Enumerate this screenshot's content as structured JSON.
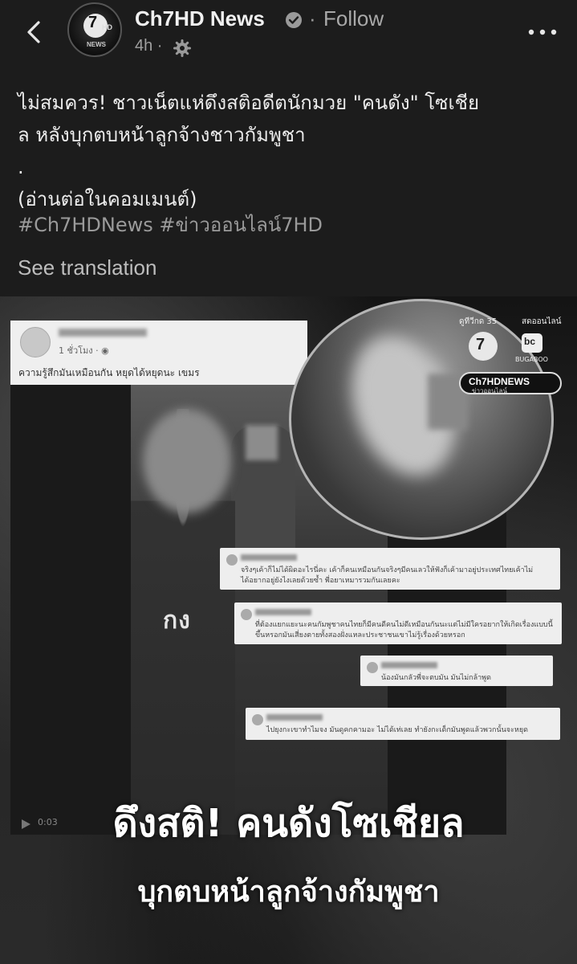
{
  "header": {
    "page_name": "Ch7HD News",
    "separator": "·",
    "follow_label": "Follow",
    "time": "4h ·",
    "avatar_text": {
      "seven": "7",
      "hd": "HD",
      "news": "NEWS"
    }
  },
  "post": {
    "caption_lines": [
      "ไม่สมควร! ชาวเน็ตแห่ดึงสติอดีตนักมวย \"คนดัง\" โซเชีย",
      "ล หลังบุกตบหน้าลูกจ้างชาวกัมพูชา",
      ".",
      "(อ่านต่อในคอมเมนต์)"
    ],
    "hashtags": "#Ch7HDNews #ข่าวออนไลน์7HD",
    "see_translation": "See translation"
  },
  "media": {
    "fb_card": {
      "time": "1 ชั่วโมง · ◉",
      "text": "ความรู้สึกมันเหมือนกัน หยุดได้หยุดนะ เขมร"
    },
    "logos": {
      "ch7_label": "ดูทีวีกด 35",
      "ch7_logo": "7",
      "live_label": "สดออนไลน์",
      "bugaboo_logo": "bc",
      "bugaboo_label": "BUGABOO",
      "news_pill_top": "Ch7HDNEWS",
      "news_pill_bottom": "ข่าวออนไลน์"
    },
    "jersey_text": "กง",
    "video_time": "0:03",
    "comments": [
      {
        "text": "จริงๆเค้าก็ไม่ได้ผิดอะไรนี่คะ เค้าก็คนเหมือนกันจริงๆมีคนเลวให้ฟังก็เค้ามาอยู่ประเทศไทยเค้าไม่\nได้อยากอยู่ยังไงเลยด้วยซ้ำ พี่อยาเหมารวมกันเลยคะ"
      },
      {
        "text": "ที่ต้องแยกแยะนะคนกัมพูชาคนไทยก็มีคนดีคนไม่ดีเหมือนกันนะแต่ไม่มีใครอยากให้เกิดเรื่องแบบนี้\nขึ้นหรอกมันเสี่ยงตายทั้งสองฝั่งแหละประชาชนเขาไม่รู้เรื่องด้วยหรอก"
      },
      {
        "text": "น้องมันกลัวพี่จะตบมัน มันไม่กล้าพูด"
      },
      {
        "text": "ไปยุงกะเขาทำไมจง มันดูคกคามอะ ไม่ได้เท่เลย ทำยังกะเด็กมันพูดแล้วพวกนั้นจะหยุด"
      }
    ],
    "headline_line1": "ดึงสติ! คนดังโซเชียล",
    "headline_line2": "บุกตบหน้าลูกจ้างกัมพูชา"
  },
  "icons": [
    "back-arrow-icon",
    "verified-badge-icon",
    "audience-gear-icon",
    "more-options-icon",
    "play-icon"
  ]
}
